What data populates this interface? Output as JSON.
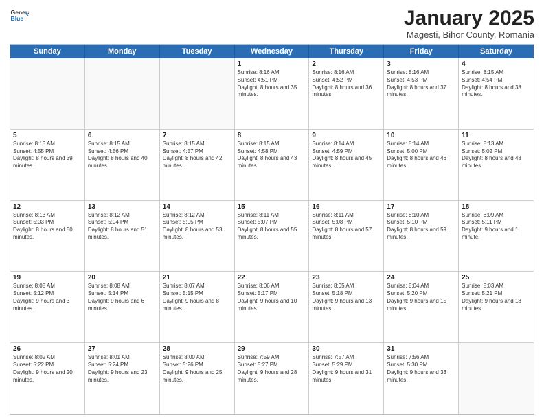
{
  "header": {
    "logo_general": "General",
    "logo_blue": "Blue",
    "month": "January 2025",
    "location": "Magesti, Bihor County, Romania"
  },
  "days_of_week": [
    "Sunday",
    "Monday",
    "Tuesday",
    "Wednesday",
    "Thursday",
    "Friday",
    "Saturday"
  ],
  "rows": [
    [
      {
        "day": "",
        "empty": true
      },
      {
        "day": "",
        "empty": true
      },
      {
        "day": "",
        "empty": true
      },
      {
        "day": "1",
        "sunrise": "8:16 AM",
        "sunset": "4:51 PM",
        "daylight": "8 hours and 35 minutes."
      },
      {
        "day": "2",
        "sunrise": "8:16 AM",
        "sunset": "4:52 PM",
        "daylight": "8 hours and 36 minutes."
      },
      {
        "day": "3",
        "sunrise": "8:16 AM",
        "sunset": "4:53 PM",
        "daylight": "8 hours and 37 minutes."
      },
      {
        "day": "4",
        "sunrise": "8:15 AM",
        "sunset": "4:54 PM",
        "daylight": "8 hours and 38 minutes."
      }
    ],
    [
      {
        "day": "5",
        "sunrise": "8:15 AM",
        "sunset": "4:55 PM",
        "daylight": "8 hours and 39 minutes."
      },
      {
        "day": "6",
        "sunrise": "8:15 AM",
        "sunset": "4:56 PM",
        "daylight": "8 hours and 40 minutes."
      },
      {
        "day": "7",
        "sunrise": "8:15 AM",
        "sunset": "4:57 PM",
        "daylight": "8 hours and 42 minutes."
      },
      {
        "day": "8",
        "sunrise": "8:15 AM",
        "sunset": "4:58 PM",
        "daylight": "8 hours and 43 minutes."
      },
      {
        "day": "9",
        "sunrise": "8:14 AM",
        "sunset": "4:59 PM",
        "daylight": "8 hours and 45 minutes."
      },
      {
        "day": "10",
        "sunrise": "8:14 AM",
        "sunset": "5:00 PM",
        "daylight": "8 hours and 46 minutes."
      },
      {
        "day": "11",
        "sunrise": "8:13 AM",
        "sunset": "5:02 PM",
        "daylight": "8 hours and 48 minutes."
      }
    ],
    [
      {
        "day": "12",
        "sunrise": "8:13 AM",
        "sunset": "5:03 PM",
        "daylight": "8 hours and 50 minutes."
      },
      {
        "day": "13",
        "sunrise": "8:12 AM",
        "sunset": "5:04 PM",
        "daylight": "8 hours and 51 minutes."
      },
      {
        "day": "14",
        "sunrise": "8:12 AM",
        "sunset": "5:05 PM",
        "daylight": "8 hours and 53 minutes."
      },
      {
        "day": "15",
        "sunrise": "8:11 AM",
        "sunset": "5:07 PM",
        "daylight": "8 hours and 55 minutes."
      },
      {
        "day": "16",
        "sunrise": "8:11 AM",
        "sunset": "5:08 PM",
        "daylight": "8 hours and 57 minutes."
      },
      {
        "day": "17",
        "sunrise": "8:10 AM",
        "sunset": "5:10 PM",
        "daylight": "8 hours and 59 minutes."
      },
      {
        "day": "18",
        "sunrise": "8:09 AM",
        "sunset": "5:11 PM",
        "daylight": "9 hours and 1 minute."
      }
    ],
    [
      {
        "day": "19",
        "sunrise": "8:08 AM",
        "sunset": "5:12 PM",
        "daylight": "9 hours and 3 minutes."
      },
      {
        "day": "20",
        "sunrise": "8:08 AM",
        "sunset": "5:14 PM",
        "daylight": "9 hours and 6 minutes."
      },
      {
        "day": "21",
        "sunrise": "8:07 AM",
        "sunset": "5:15 PM",
        "daylight": "9 hours and 8 minutes."
      },
      {
        "day": "22",
        "sunrise": "8:06 AM",
        "sunset": "5:17 PM",
        "daylight": "9 hours and 10 minutes."
      },
      {
        "day": "23",
        "sunrise": "8:05 AM",
        "sunset": "5:18 PM",
        "daylight": "9 hours and 13 minutes."
      },
      {
        "day": "24",
        "sunrise": "8:04 AM",
        "sunset": "5:20 PM",
        "daylight": "9 hours and 15 minutes."
      },
      {
        "day": "25",
        "sunrise": "8:03 AM",
        "sunset": "5:21 PM",
        "daylight": "9 hours and 18 minutes."
      }
    ],
    [
      {
        "day": "26",
        "sunrise": "8:02 AM",
        "sunset": "5:22 PM",
        "daylight": "9 hours and 20 minutes."
      },
      {
        "day": "27",
        "sunrise": "8:01 AM",
        "sunset": "5:24 PM",
        "daylight": "9 hours and 23 minutes."
      },
      {
        "day": "28",
        "sunrise": "8:00 AM",
        "sunset": "5:26 PM",
        "daylight": "9 hours and 25 minutes."
      },
      {
        "day": "29",
        "sunrise": "7:59 AM",
        "sunset": "5:27 PM",
        "daylight": "9 hours and 28 minutes."
      },
      {
        "day": "30",
        "sunrise": "7:57 AM",
        "sunset": "5:29 PM",
        "daylight": "9 hours and 31 minutes."
      },
      {
        "day": "31",
        "sunrise": "7:56 AM",
        "sunset": "5:30 PM",
        "daylight": "9 hours and 33 minutes."
      },
      {
        "day": "",
        "empty": true
      }
    ]
  ]
}
